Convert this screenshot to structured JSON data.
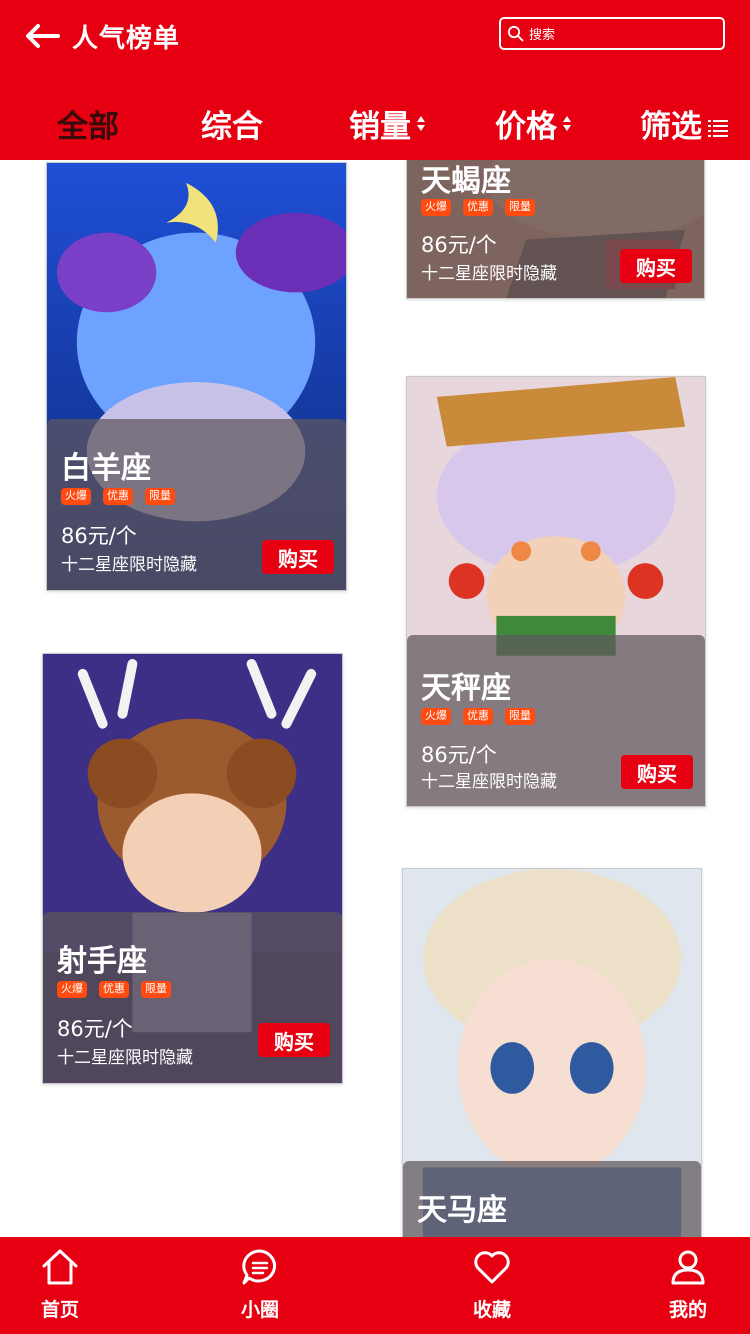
{
  "header": {
    "title": "人气榜单",
    "search_placeholder": "搜索",
    "sort_tabs": [
      {
        "label": "全部",
        "active": true
      },
      {
        "label": "综合"
      },
      {
        "label": "销量"
      },
      {
        "label": "价格"
      },
      {
        "label": "筛选"
      }
    ]
  },
  "colors": {
    "brand": "#e60012",
    "tag": "#ff4b10",
    "active_tab": "#3a0a0a"
  },
  "products": [
    {
      "name": "天蝎座",
      "tags": [
        "火爆",
        "优惠",
        "限量"
      ],
      "price": "86元/个",
      "desc": "十二星座限时隐藏",
      "buy_label": "购买"
    },
    {
      "name": "白羊座",
      "tags": [
        "火爆",
        "优惠",
        "限量"
      ],
      "price": "86元/个",
      "desc": "十二星座限时隐藏",
      "buy_label": "购买"
    },
    {
      "name": "天秤座",
      "tags": [
        "火爆",
        "优惠",
        "限量"
      ],
      "price": "86元/个",
      "desc": "十二星座限时隐藏",
      "buy_label": "购买"
    },
    {
      "name": "射手座",
      "tags": [
        "火爆",
        "优惠",
        "限量"
      ],
      "price": "86元/个",
      "desc": "十二星座限时隐藏",
      "buy_label": "购买"
    },
    {
      "name": "天马座"
    }
  ],
  "bottom_nav": [
    {
      "label": "首页",
      "icon": "home-icon"
    },
    {
      "label": "小圈",
      "icon": "chat-bubble-icon"
    },
    {
      "label": "收藏",
      "icon": "heart-icon"
    },
    {
      "label": "我的",
      "icon": "user-icon"
    }
  ]
}
